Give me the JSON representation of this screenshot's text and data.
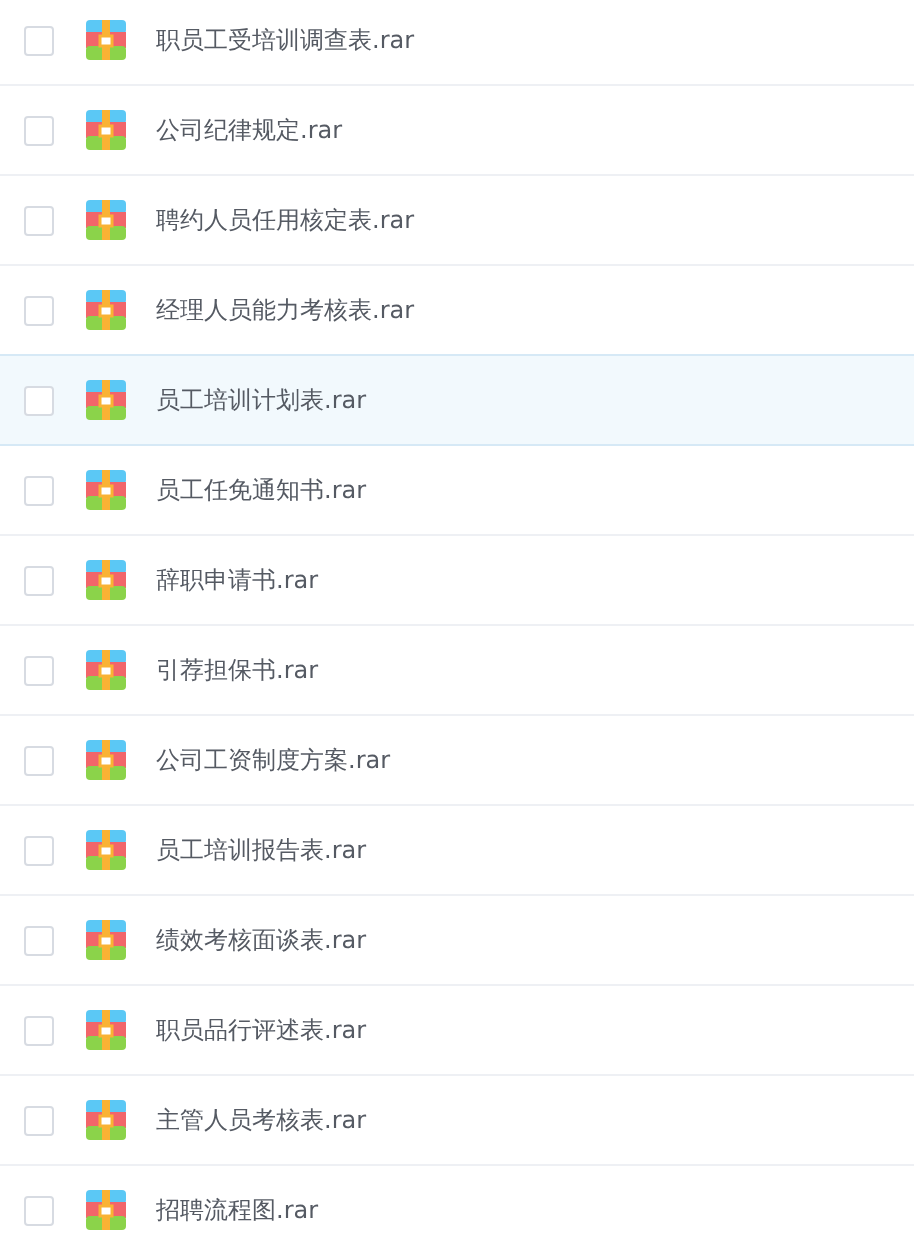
{
  "files": [
    {
      "name": "职员工受培训调查表.rar",
      "checked": false,
      "highlighted": false
    },
    {
      "name": "公司纪律规定.rar",
      "checked": false,
      "highlighted": false
    },
    {
      "name": "聘约人员任用核定表.rar",
      "checked": false,
      "highlighted": false
    },
    {
      "name": "经理人员能力考核表.rar",
      "checked": false,
      "highlighted": false
    },
    {
      "name": "员工培训计划表.rar",
      "checked": false,
      "highlighted": true
    },
    {
      "name": "员工任免通知书.rar",
      "checked": false,
      "highlighted": false
    },
    {
      "name": "辞职申请书.rar",
      "checked": false,
      "highlighted": false
    },
    {
      "name": "引荐担保书.rar",
      "checked": false,
      "highlighted": false
    },
    {
      "name": "公司工资制度方案.rar",
      "checked": false,
      "highlighted": false
    },
    {
      "name": "员工培训报告表.rar",
      "checked": false,
      "highlighted": false
    },
    {
      "name": "绩效考核面谈表.rar",
      "checked": false,
      "highlighted": false
    },
    {
      "name": "职员品行评述表.rar",
      "checked": false,
      "highlighted": false
    },
    {
      "name": "主管人员考核表.rar",
      "checked": false,
      "highlighted": false
    },
    {
      "name": "招聘流程图.rar",
      "checked": false,
      "highlighted": false
    }
  ]
}
